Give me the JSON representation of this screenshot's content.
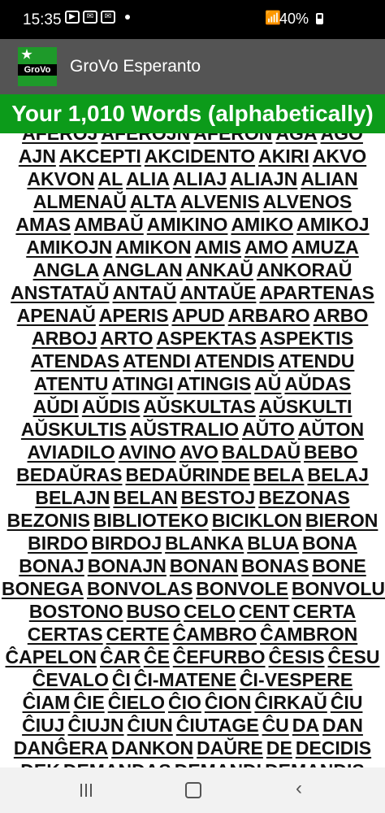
{
  "status_bar": {
    "time": "15:35",
    "battery": "40%"
  },
  "app_bar": {
    "title": "GroVo Esperanto",
    "logo_text": "GroVo"
  },
  "banner": {
    "text": "Your 1,010 Words (alphabetically)"
  },
  "word_rows": [
    [
      "AFEROJ",
      "AFEROJN",
      "AFERON",
      "AGA",
      "AGO"
    ],
    [
      "AJN",
      "AKCEPTI",
      "AKCIDENTO",
      "AKIRI",
      "AKVO"
    ],
    [
      "AKVON",
      "AL",
      "ALIA",
      "ALIAJ",
      "ALIAJN",
      "ALIAN"
    ],
    [
      "ALMENAŬ",
      "ALTA",
      "ALVENIS",
      "ALVENOS"
    ],
    [
      "AMAS",
      "AMBAŬ",
      "AMIKINO",
      "AMIKO",
      "AMIKOJ"
    ],
    [
      "AMIKOJN",
      "AMIKON",
      "AMIS",
      "AMO",
      "AMUZA"
    ],
    [
      "ANGLA",
      "ANGLAN",
      "ANKAŬ",
      "ANKORAŬ"
    ],
    [
      "ANSTATAŬ",
      "ANTAŬ",
      "ANTAŬE",
      "APARTENAS"
    ],
    [
      "APENAŬ",
      "APERIS",
      "APUD",
      "ARBARO",
      "ARBO"
    ],
    [
      "ARBOJ",
      "ARTO",
      "ASPEKTAS",
      "ASPEKTIS"
    ],
    [
      "ATENDAS",
      "ATENDI",
      "ATENDIS",
      "ATENDU"
    ],
    [
      "ATENTU",
      "ATINGI",
      "ATINGIS",
      "AŬ",
      "AŬDAS"
    ],
    [
      "AŬDI",
      "AŬDIS",
      "AŬSKULTAS",
      "AŬSKULTI"
    ],
    [
      "AŬSKULTIS",
      "AŬSTRALIO",
      "AŬTO",
      "AŬTON"
    ],
    [
      "AVIADILO",
      "AVINO",
      "AVO",
      "BALDAŬ",
      "BEBO"
    ],
    [
      "BEDAŬRAS",
      "BEDAŬRINDE",
      "BELA",
      "BELAJ"
    ],
    [
      "BELAJN",
      "BELAN",
      "BESTOJ",
      "BEZONAS"
    ],
    [
      "BEZONIS",
      "BIBLIOTEKO",
      "BICIKLON",
      "BIERON"
    ],
    [
      "BIRDO",
      "BIRDOJ",
      "BLANKA",
      "BLUA",
      "BONA"
    ],
    [
      "BONAJ",
      "BONAJN",
      "BONAN",
      "BONAS",
      "BONE"
    ],
    [
      "BONEGA",
      "BONVOLAS",
      "BONVOLE",
      "BONVOLU"
    ],
    [
      "BOSTONO",
      "BUSO",
      "CELO",
      "CENT",
      "CERTA"
    ],
    [
      "CERTAS",
      "CERTE",
      "ĈAMBRO",
      "ĈAMBRON"
    ],
    [
      "ĈAPELON",
      "ĈAR",
      "ĈE",
      "ĈEFURBO",
      "ĈESIS",
      "ĈESU"
    ],
    [
      "ĈEVALO",
      "ĈI",
      "ĈI-MATENE",
      "ĈI-VESPERE"
    ],
    [
      "ĈIAM",
      "ĈIE",
      "ĈIELO",
      "ĈIO",
      "ĈION",
      "ĈIRKAŬ",
      "ĈIU"
    ],
    [
      "ĈIUJ",
      "ĈIUJN",
      "ĈIUN",
      "ĈIUTAGE",
      "ĈU",
      "DA",
      "DAN"
    ],
    [
      "DANĜERA",
      "DANKON",
      "DAŬRE",
      "DE",
      "DECIDIS"
    ],
    [
      "DEK",
      "DEMANDAS",
      "DEMANDI",
      "DEMANDIS"
    ]
  ]
}
